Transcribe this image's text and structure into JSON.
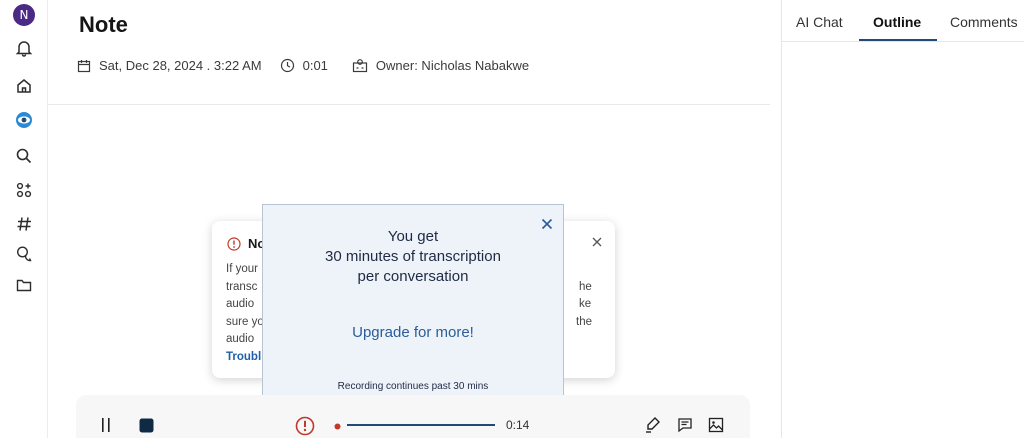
{
  "user": {
    "initial": "N"
  },
  "note": {
    "title": "Note",
    "date": "Sat, Dec 28, 2024 . 3:22 AM",
    "duration": "0:01",
    "owner": "Owner: Nicholas Nabakwe"
  },
  "right_panel": {
    "tabs": [
      {
        "label": "AI Chat"
      },
      {
        "label": "Outline"
      },
      {
        "label": "Comments"
      }
    ],
    "active_tab": "Outline"
  },
  "notice": {
    "title": "No",
    "line1": "If your",
    "line2": "transc",
    "line2_tail": "he",
    "line3": "audio",
    "line3_tail": "ke",
    "line4": "sure yo",
    "line4_tail": "the",
    "line5": "audio",
    "link": "Troubl"
  },
  "modal": {
    "line1": "You get",
    "line2": "30 minutes of transcription",
    "line3": "per conversation",
    "upgrade": "Upgrade for more!",
    "footer": "Recording continues past 30 mins"
  },
  "recorder": {
    "elapsed": "0:14"
  },
  "colors": {
    "accent": "#1f4a7a",
    "avatar": "#4b2a86",
    "warning": "#c0392b",
    "modal_bg": "#eef2f9"
  },
  "icons": {
    "rail": [
      "bell-icon",
      "home-icon",
      "eye-icon",
      "search-icon",
      "apps-icon",
      "hashtag-icon",
      "chat-icon",
      "folder-icon"
    ],
    "toolbar": [
      "pause-icon",
      "stop-icon",
      "warning-icon",
      "pen-icon",
      "comment-icon",
      "image-icon"
    ]
  }
}
